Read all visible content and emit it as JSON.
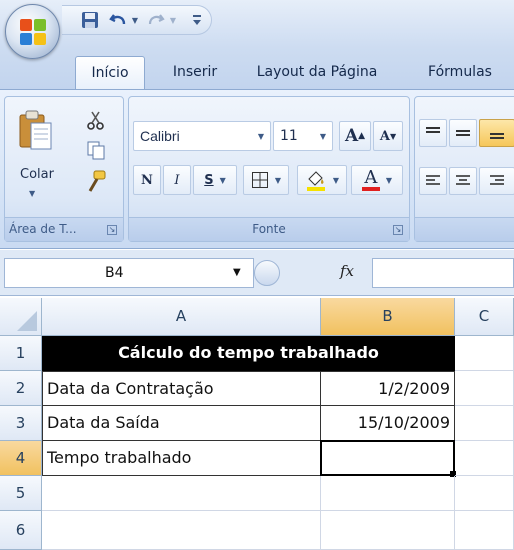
{
  "colors": {
    "accent": "#f1c15f",
    "ribbon": "#d7e5f7",
    "header_fill": "#000000"
  },
  "tabs": [
    {
      "label": "Início",
      "active": true
    },
    {
      "label": "Inserir"
    },
    {
      "label": "Layout da Página"
    },
    {
      "label": "Fórmulas"
    }
  ],
  "clipboard": {
    "paste_label": "Colar",
    "group_title": "Área de T..."
  },
  "font": {
    "family_value": "Calibri",
    "size_value": "11",
    "grow_label": "A",
    "shrink_label": "A",
    "bold": "N",
    "italic": "I",
    "underline": "S",
    "fontcolor": "A",
    "group_title": "Fonte"
  },
  "namebox": {
    "value": "B4"
  },
  "formula": {
    "fx": "fx",
    "value": ""
  },
  "sheet": {
    "columns": [
      "A",
      "B",
      "C"
    ],
    "rows": [
      "1",
      "2",
      "3",
      "4",
      "5",
      "6"
    ],
    "title": "Cálculo do tempo trabalhado",
    "cells": [
      {
        "label": "Data da Contratação",
        "value": "1/2/2009"
      },
      {
        "label": "Data da Saída",
        "value": "15/10/2009"
      },
      {
        "label": "Tempo trabalhado",
        "value": ""
      }
    ],
    "active_cell": "B4"
  }
}
